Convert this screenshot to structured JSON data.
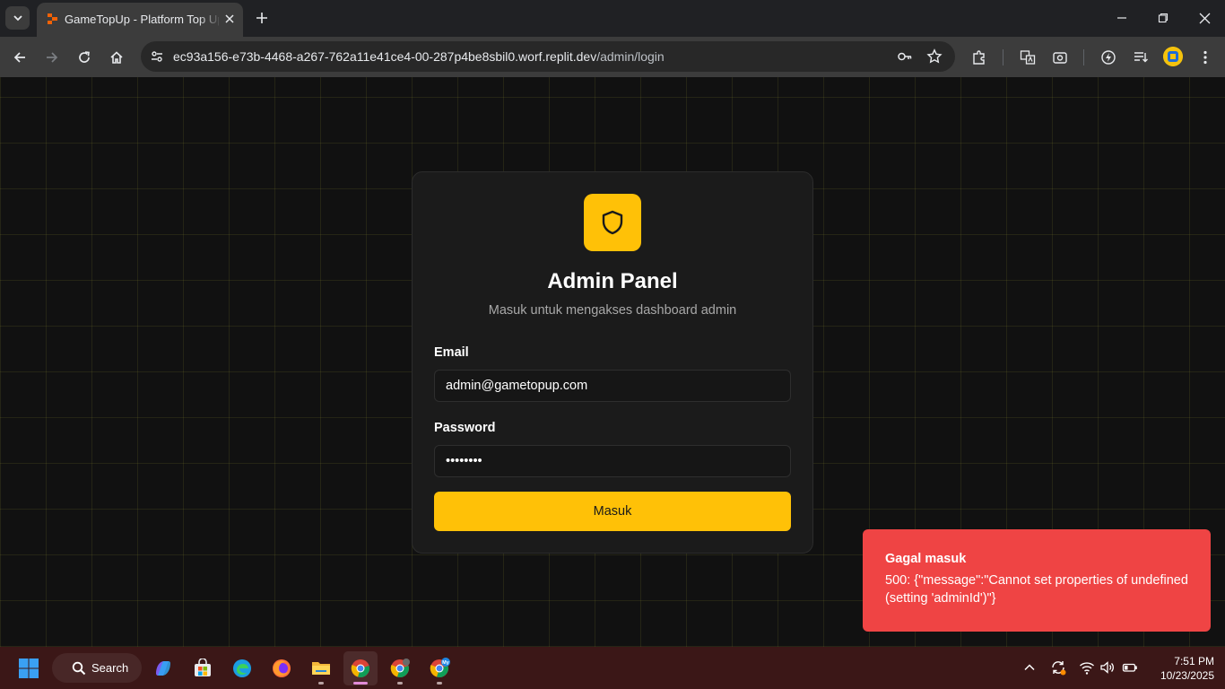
{
  "browser": {
    "tab_title": "GameTopUp - Platform Top Up",
    "url_host": "ec93a156-e73b-4468-a267-762a11e41ce4-00-287p4be8sbil0.worf.replit.dev",
    "url_path": "/admin/login"
  },
  "login": {
    "title": "Admin Panel",
    "subtitle": "Masuk untuk mengakses dashboard admin",
    "email_label": "Email",
    "email_value": "admin@gametopup.com",
    "password_label": "Password",
    "password_value": "••••••••",
    "submit_label": "Masuk"
  },
  "toast": {
    "title": "Gagal masuk",
    "message": "500: {\"message\":\"Cannot set properties of undefined (setting 'adminId')\"}"
  },
  "taskbar": {
    "search_label": "Search",
    "time": "7:51 PM",
    "date": "10/23/2025",
    "badge_label": "My"
  },
  "colors": {
    "accent": "#ffc107",
    "toast_error": "#ef4444",
    "page_bg": "#111111",
    "card_bg": "#1b1b1b"
  }
}
